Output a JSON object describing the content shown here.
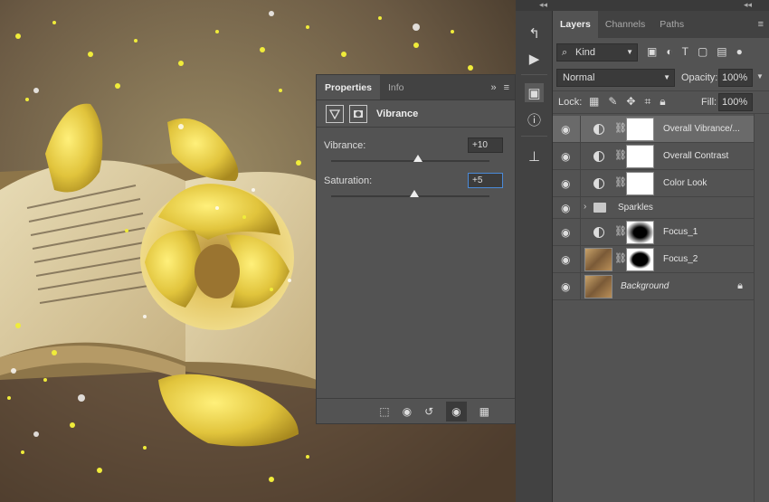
{
  "properties_panel": {
    "tabs": [
      {
        "label": "Properties",
        "active": true
      },
      {
        "label": "Info",
        "active": false
      }
    ],
    "expand_glyph": "»",
    "menu_glyph": "≡",
    "adjustment_name": "Vibrance",
    "sliders": [
      {
        "label": "Vibrance:",
        "value": "+10",
        "level": 10,
        "range": [
          -100,
          100
        ],
        "focused": false
      },
      {
        "label": "Saturation:",
        "value": "+5",
        "level": 5,
        "range": [
          -100,
          100
        ],
        "focused": true
      }
    ],
    "footer_icons": [
      "clip-to-layer-icon",
      "view-previous-icon",
      "reset-icon",
      "visibility-icon",
      "trash-icon"
    ]
  },
  "tool_strip": {
    "collapse_glyph": "◂◂",
    "items": [
      "history-icon",
      "play-actions-icon",
      "properties-cube-icon",
      "info-icon",
      "clone-source-icon"
    ]
  },
  "layers_panel": {
    "tabs": [
      {
        "label": "Layers",
        "active": true
      },
      {
        "label": "Channels",
        "active": false
      },
      {
        "label": "Paths",
        "active": false
      }
    ],
    "menu_glyph": "≡",
    "filter": {
      "label": "Kind"
    },
    "blend_mode": "Normal",
    "opacity_label": "Opacity:",
    "opacity": "100%",
    "lock_label": "Lock:",
    "fill_label": "Fill:",
    "fill": "100%",
    "layers": [
      {
        "name": "Overall Vibrance/...",
        "type": "adjustment",
        "selected": true
      },
      {
        "name": "Overall Contrast",
        "type": "adjustment",
        "selected": false
      },
      {
        "name": "Color Look",
        "type": "adjustment",
        "selected": false
      },
      {
        "name": "Sparkles",
        "type": "group",
        "selected": false
      },
      {
        "name": "Focus_1",
        "type": "adjustment-mask",
        "selected": false
      },
      {
        "name": "Focus_2",
        "type": "pixel-mask",
        "selected": false
      },
      {
        "name": "Background",
        "type": "background",
        "selected": false,
        "locked": true
      }
    ]
  },
  "colors": {
    "panel_bg": "#535353",
    "tab_bar": "#424242",
    "selected_layer": "#6a6a6a",
    "focus_accent": "#4a8ad8",
    "sparkle": "#f0ec3a"
  }
}
